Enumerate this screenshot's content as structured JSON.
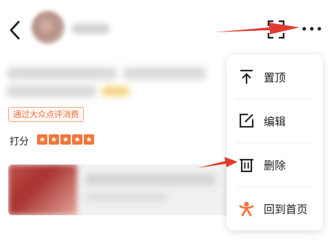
{
  "header": {
    "icons": {
      "back": "chevron-left-icon",
      "expand": "expand-icon",
      "more": "more-horizontal-icon"
    }
  },
  "review": {
    "source_tag": "通过大众点评消费",
    "rating_label": "打分",
    "rating": 5,
    "rating_max": 5
  },
  "menu": {
    "items": [
      {
        "label": "置顶",
        "icon": "pin-top-icon"
      },
      {
        "label": "编辑",
        "icon": "edit-icon"
      },
      {
        "label": "删除",
        "icon": "trash-icon"
      },
      {
        "label": "回到首页",
        "icon": "home-mascot-icon"
      }
    ]
  },
  "colors": {
    "accent": "#f2753a",
    "annotation_arrow": "#e23a2e",
    "text": "#222222"
  }
}
